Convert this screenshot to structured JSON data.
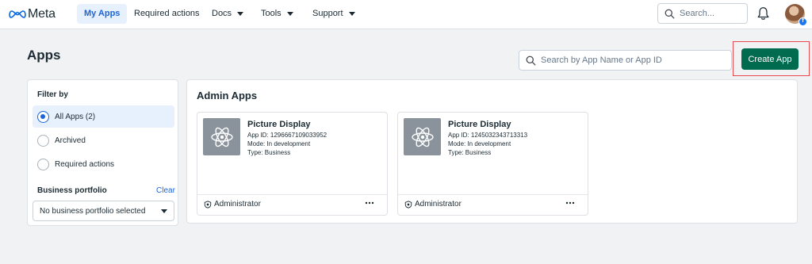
{
  "nav": {
    "logo_text": "Meta",
    "items": [
      {
        "label": "My Apps",
        "active": true
      },
      {
        "label": "Required actions"
      },
      {
        "label": "Docs"
      },
      {
        "label": "Tools"
      },
      {
        "label": "Support"
      }
    ],
    "search_placeholder": "Search...",
    "icons": [
      "meta-logo-icon",
      "search-icon",
      "bell-icon",
      "avatar"
    ]
  },
  "page": {
    "title": "Apps",
    "search_placeholder": "Search by App Name or App ID",
    "create_button": "Create App"
  },
  "filter": {
    "heading": "Filter by",
    "options": [
      {
        "label": "All Apps (2)",
        "selected": true
      },
      {
        "label": "Archived",
        "selected": false
      },
      {
        "label": "Required actions",
        "selected": false
      }
    ],
    "business_portfolio_heading": "Business portfolio",
    "clear_label": "Clear",
    "business_portfolio_value": "No business portfolio selected"
  },
  "admin": {
    "heading": "Admin Apps",
    "apps": [
      {
        "name": "Picture Display",
        "app_id": "App ID: 1296667109033952",
        "mode": "Mode: In development",
        "type": "Type: Business",
        "role": "Administrator"
      },
      {
        "name": "Picture Display",
        "app_id": "App ID: 1245032343713313",
        "mode": "Mode: In development",
        "type": "Type: Business",
        "role": "Administrator"
      }
    ]
  },
  "colors": {
    "accent": "#1d65d6",
    "create_button": "#006b4f",
    "highlight": "#e84a50"
  }
}
